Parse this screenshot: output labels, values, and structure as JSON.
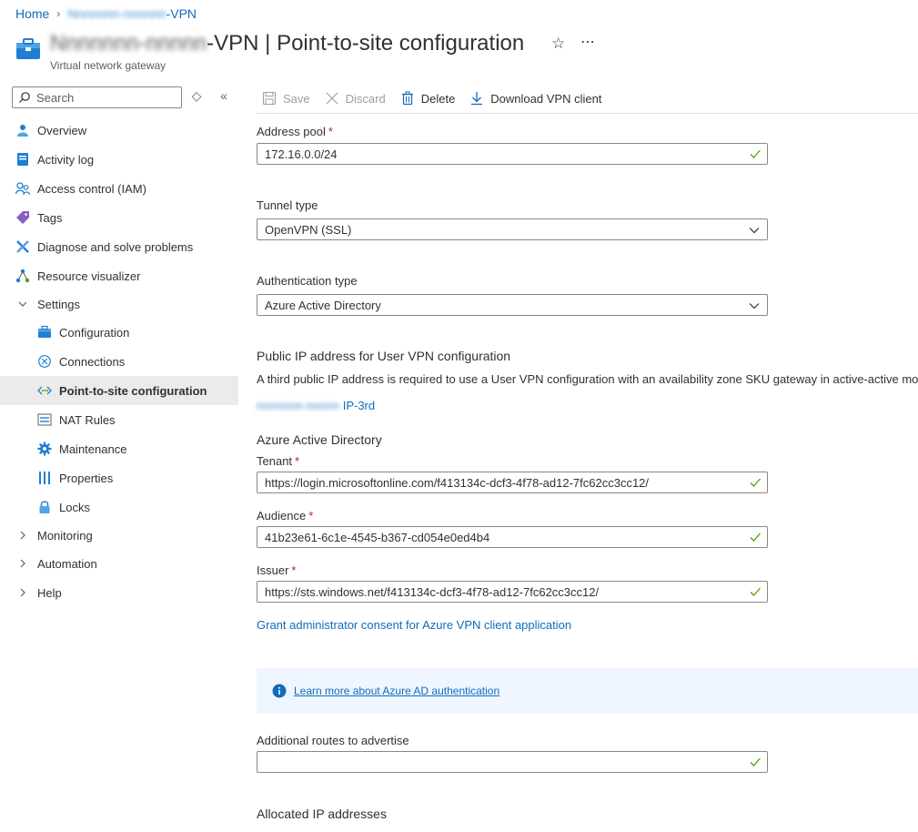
{
  "breadcrumb": {
    "home": "Home",
    "resource_suffix": "-VPN",
    "resource_blur": "Nnnnnnn-nnnnnn"
  },
  "header": {
    "title_blur": "Nnnnnnn-nnnnn",
    "title_suffix": "-VPN",
    "title_separator": "|",
    "title_page": "Point-to-site configuration",
    "subtitle": "Virtual network gateway"
  },
  "search": {
    "placeholder": "Search"
  },
  "sidebar": {
    "items": [
      {
        "label": "Overview",
        "icon": "overview-icon"
      },
      {
        "label": "Activity log",
        "icon": "activity-log-icon"
      },
      {
        "label": "Access control (IAM)",
        "icon": "iam-icon"
      },
      {
        "label": "Tags",
        "icon": "tag-icon"
      },
      {
        "label": "Diagnose and solve problems",
        "icon": "wrench-icon"
      },
      {
        "label": "Resource visualizer",
        "icon": "visualizer-icon"
      }
    ],
    "settings_label": "Settings",
    "settings_items": [
      {
        "label": "Configuration",
        "icon": "configuration-icon"
      },
      {
        "label": "Connections",
        "icon": "connections-icon"
      },
      {
        "label": "Point-to-site configuration",
        "icon": "point-to-site-icon"
      },
      {
        "label": "NAT Rules",
        "icon": "nat-rules-icon"
      },
      {
        "label": "Maintenance",
        "icon": "gear-icon"
      },
      {
        "label": "Properties",
        "icon": "properties-icon"
      },
      {
        "label": "Locks",
        "icon": "lock-icon"
      }
    ],
    "groups": [
      {
        "label": "Monitoring"
      },
      {
        "label": "Automation"
      },
      {
        "label": "Help"
      }
    ]
  },
  "toolbar": {
    "save": "Save",
    "discard": "Discard",
    "delete": "Delete",
    "download": "Download VPN client"
  },
  "form": {
    "address_pool_label": "Address pool",
    "address_pool_value": "172.16.0.0/24",
    "tunnel_type_label": "Tunnel type",
    "tunnel_type_value": "OpenVPN (SSL)",
    "auth_type_label": "Authentication type",
    "auth_type_value": "Azure Active Directory",
    "public_ip_title": "Public IP address for User VPN configuration",
    "public_ip_desc": "A third public IP address is required to use a User VPN configuration with an availability zone SKU gateway in active-active mode.",
    "public_ip_link_blur": "nnnnnnn-nnnnn",
    "public_ip_link_suffix": "IP-3rd",
    "aad_title": "Azure Active Directory",
    "tenant_label": "Tenant",
    "tenant_value": "https://login.microsoftonline.com/f413134c-dcf3-4f78-ad12-7fc62cc3cc12/",
    "audience_label": "Audience",
    "audience_value": "41b23e61-6c1e-4545-b367-cd054e0ed4b4",
    "issuer_label": "Issuer",
    "issuer_value": "https://sts.windows.net/f413134c-dcf3-4f78-ad12-7fc62cc3cc12/",
    "grant_link": "Grant administrator consent for Azure VPN client application",
    "info_link": "Learn more about Azure AD authentication",
    "routes_label": "Additional routes to advertise",
    "routes_value": "",
    "allocated_label": "Allocated IP addresses",
    "required_marker": "*"
  },
  "colors": {
    "accent": "#0f6cbd",
    "valid": "#57a300",
    "required": "#a4262c",
    "info_bg": "#f0f6ff"
  }
}
